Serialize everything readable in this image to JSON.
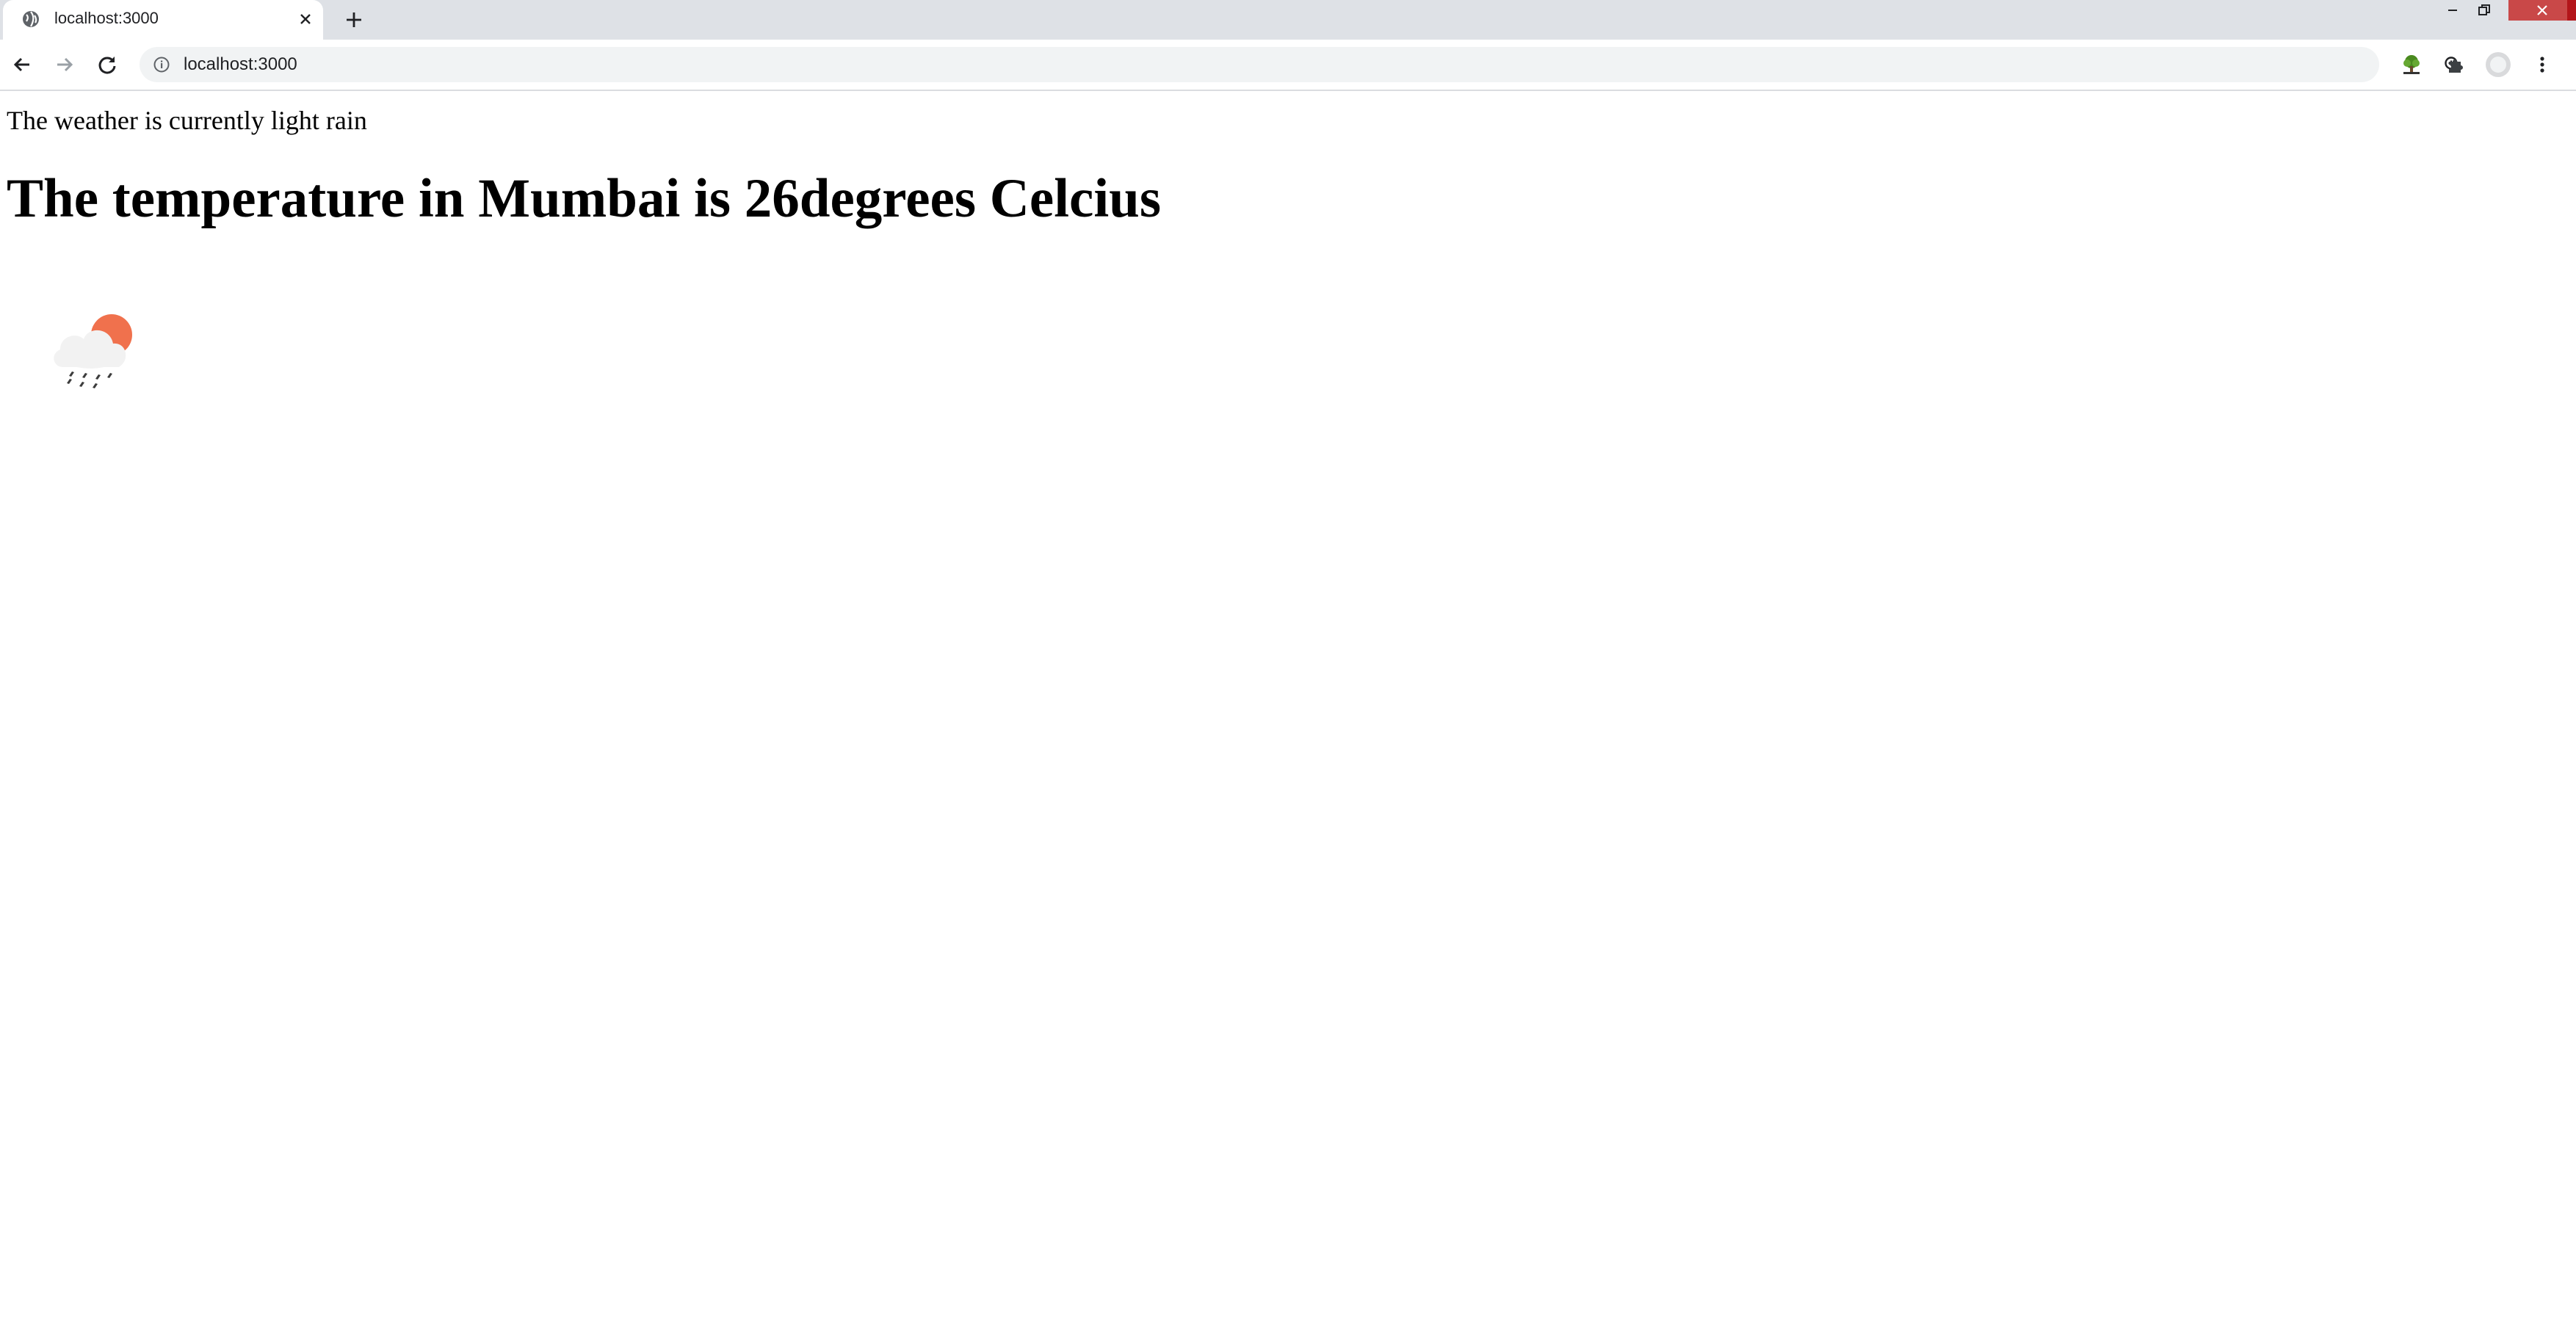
{
  "browser": {
    "tab": {
      "title": "localhost:3000",
      "favicon": "globe-icon"
    },
    "address_bar": {
      "url": "localhost:3000",
      "site_info_icon": "info-icon"
    },
    "toolbar_icons": [
      "back-icon",
      "forward-icon",
      "reload-icon",
      "zoom-icon",
      "star-icon",
      "extension-tree-icon",
      "puzzle-icon",
      "profile-icon",
      "menu-icon"
    ],
    "window_controls": [
      "minimize-icon",
      "restore-icon",
      "close-icon"
    ],
    "colors": {
      "close_button": "#c94848",
      "tabbar": "#dee1e6"
    }
  },
  "page": {
    "weather_description": "The weather is currently light rain",
    "temperature_heading": "The temperature in Mumbai is 26degrees Celcius",
    "weather_icon": "light-rain-sun-icon",
    "colors": {
      "sun": "#f0714d",
      "cloud": "#f2f2f2",
      "rain": "#3c3c3c"
    }
  }
}
